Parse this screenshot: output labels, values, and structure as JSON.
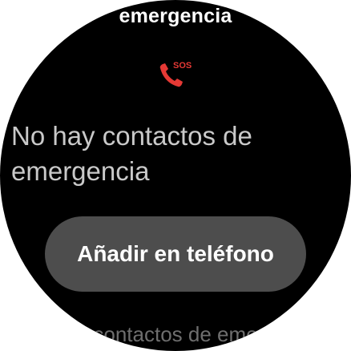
{
  "header": {
    "title": "emergencia"
  },
  "icon": {
    "name": "sos-phone-icon",
    "label": "SOS",
    "color": "#e53935"
  },
  "main": {
    "message": "No hay contactos de emergencia",
    "add_button_label": "Añadir en teléfono"
  },
  "footer": {
    "text": "contactos de eme"
  },
  "colors": {
    "background": "#000000",
    "button": "#4d4d4d",
    "accent": "#e53935"
  }
}
